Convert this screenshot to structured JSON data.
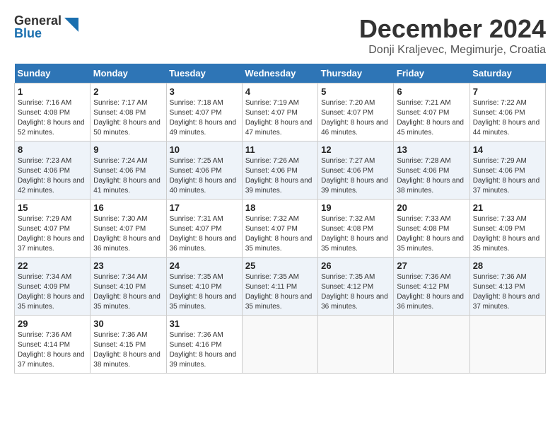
{
  "header": {
    "logo_general": "General",
    "logo_blue": "Blue",
    "month_title": "December 2024",
    "location": "Donji Kraljevec, Megimurje, Croatia"
  },
  "weekdays": [
    "Sunday",
    "Monday",
    "Tuesday",
    "Wednesday",
    "Thursday",
    "Friday",
    "Saturday"
  ],
  "weeks": [
    [
      {
        "day": "1",
        "sunrise": "7:16 AM",
        "sunset": "4:08 PM",
        "daylight": "8 hours and 52 minutes."
      },
      {
        "day": "2",
        "sunrise": "7:17 AM",
        "sunset": "4:08 PM",
        "daylight": "8 hours and 50 minutes."
      },
      {
        "day": "3",
        "sunrise": "7:18 AM",
        "sunset": "4:07 PM",
        "daylight": "8 hours and 49 minutes."
      },
      {
        "day": "4",
        "sunrise": "7:19 AM",
        "sunset": "4:07 PM",
        "daylight": "8 hours and 47 minutes."
      },
      {
        "day": "5",
        "sunrise": "7:20 AM",
        "sunset": "4:07 PM",
        "daylight": "8 hours and 46 minutes."
      },
      {
        "day": "6",
        "sunrise": "7:21 AM",
        "sunset": "4:07 PM",
        "daylight": "8 hours and 45 minutes."
      },
      {
        "day": "7",
        "sunrise": "7:22 AM",
        "sunset": "4:06 PM",
        "daylight": "8 hours and 44 minutes."
      }
    ],
    [
      {
        "day": "8",
        "sunrise": "7:23 AM",
        "sunset": "4:06 PM",
        "daylight": "8 hours and 42 minutes."
      },
      {
        "day": "9",
        "sunrise": "7:24 AM",
        "sunset": "4:06 PM",
        "daylight": "8 hours and 41 minutes."
      },
      {
        "day": "10",
        "sunrise": "7:25 AM",
        "sunset": "4:06 PM",
        "daylight": "8 hours and 40 minutes."
      },
      {
        "day": "11",
        "sunrise": "7:26 AM",
        "sunset": "4:06 PM",
        "daylight": "8 hours and 39 minutes."
      },
      {
        "day": "12",
        "sunrise": "7:27 AM",
        "sunset": "4:06 PM",
        "daylight": "8 hours and 39 minutes."
      },
      {
        "day": "13",
        "sunrise": "7:28 AM",
        "sunset": "4:06 PM",
        "daylight": "8 hours and 38 minutes."
      },
      {
        "day": "14",
        "sunrise": "7:29 AM",
        "sunset": "4:06 PM",
        "daylight": "8 hours and 37 minutes."
      }
    ],
    [
      {
        "day": "15",
        "sunrise": "7:29 AM",
        "sunset": "4:07 PM",
        "daylight": "8 hours and 37 minutes."
      },
      {
        "day": "16",
        "sunrise": "7:30 AM",
        "sunset": "4:07 PM",
        "daylight": "8 hours and 36 minutes."
      },
      {
        "day": "17",
        "sunrise": "7:31 AM",
        "sunset": "4:07 PM",
        "daylight": "8 hours and 36 minutes."
      },
      {
        "day": "18",
        "sunrise": "7:32 AM",
        "sunset": "4:07 PM",
        "daylight": "8 hours and 35 minutes."
      },
      {
        "day": "19",
        "sunrise": "7:32 AM",
        "sunset": "4:08 PM",
        "daylight": "8 hours and 35 minutes."
      },
      {
        "day": "20",
        "sunrise": "7:33 AM",
        "sunset": "4:08 PM",
        "daylight": "8 hours and 35 minutes."
      },
      {
        "day": "21",
        "sunrise": "7:33 AM",
        "sunset": "4:09 PM",
        "daylight": "8 hours and 35 minutes."
      }
    ],
    [
      {
        "day": "22",
        "sunrise": "7:34 AM",
        "sunset": "4:09 PM",
        "daylight": "8 hours and 35 minutes."
      },
      {
        "day": "23",
        "sunrise": "7:34 AM",
        "sunset": "4:10 PM",
        "daylight": "8 hours and 35 minutes."
      },
      {
        "day": "24",
        "sunrise": "7:35 AM",
        "sunset": "4:10 PM",
        "daylight": "8 hours and 35 minutes."
      },
      {
        "day": "25",
        "sunrise": "7:35 AM",
        "sunset": "4:11 PM",
        "daylight": "8 hours and 35 minutes."
      },
      {
        "day": "26",
        "sunrise": "7:35 AM",
        "sunset": "4:12 PM",
        "daylight": "8 hours and 36 minutes."
      },
      {
        "day": "27",
        "sunrise": "7:36 AM",
        "sunset": "4:12 PM",
        "daylight": "8 hours and 36 minutes."
      },
      {
        "day": "28",
        "sunrise": "7:36 AM",
        "sunset": "4:13 PM",
        "daylight": "8 hours and 37 minutes."
      }
    ],
    [
      {
        "day": "29",
        "sunrise": "7:36 AM",
        "sunset": "4:14 PM",
        "daylight": "8 hours and 37 minutes."
      },
      {
        "day": "30",
        "sunrise": "7:36 AM",
        "sunset": "4:15 PM",
        "daylight": "8 hours and 38 minutes."
      },
      {
        "day": "31",
        "sunrise": "7:36 AM",
        "sunset": "4:16 PM",
        "daylight": "8 hours and 39 minutes."
      },
      null,
      null,
      null,
      null
    ]
  ],
  "labels": {
    "sunrise": "Sunrise:",
    "sunset": "Sunset:",
    "daylight": "Daylight:"
  }
}
